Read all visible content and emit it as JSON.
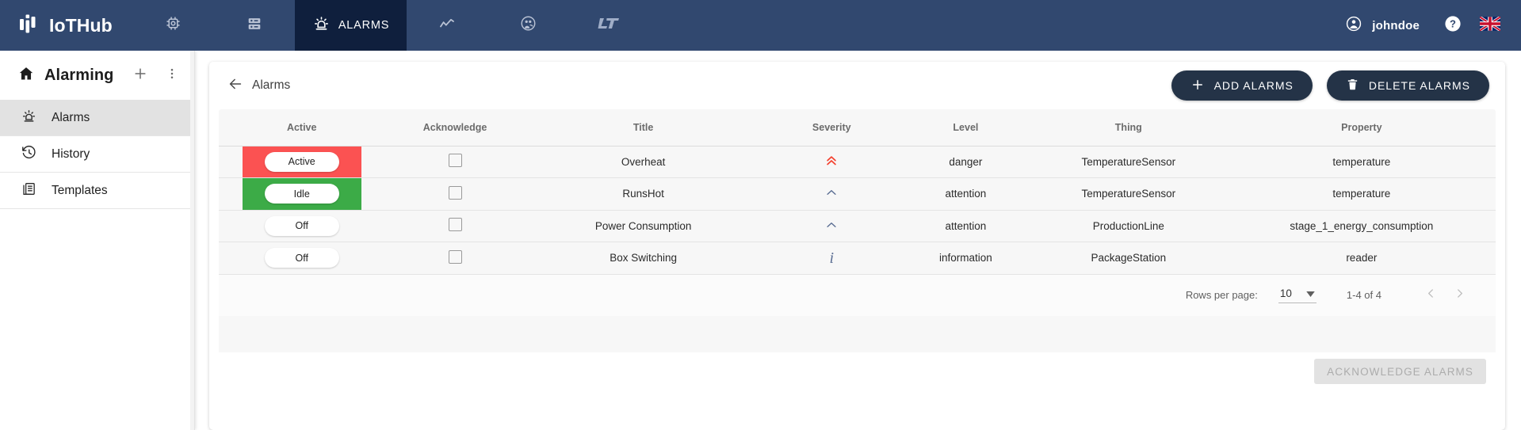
{
  "topnav": {
    "brand": "IoTHub",
    "items": [
      {
        "icon": "chip-icon",
        "label": "",
        "name": "nav-things",
        "active": false
      },
      {
        "icon": "server-rack-icon",
        "label": "",
        "name": "nav-servers",
        "active": false
      },
      {
        "icon": "alarm-light-icon",
        "label": "ALARMS",
        "name": "nav-alarms",
        "active": true
      },
      {
        "icon": "line-chart-icon",
        "label": "",
        "name": "nav-analytics",
        "active": false
      },
      {
        "icon": "users-circle-icon",
        "label": "",
        "name": "nav-users",
        "active": false
      },
      {
        "icon": "lt-logo-icon",
        "label": "",
        "name": "nav-lt-logo",
        "active": false
      }
    ],
    "user": "johndoe",
    "user_icon": "account-circle-icon",
    "help_icon": "help-circle-icon",
    "flag_icon": "uk-flag-icon",
    "bg_color": "#31486f",
    "active_bg_color": "#0f1f3d"
  },
  "sidebar": {
    "title": "Alarming",
    "home_icon": "home-icon",
    "add_icon": "plus-icon",
    "more_icon": "more-vertical-icon",
    "items": [
      {
        "label": "Alarms",
        "icon": "alarm-light-icon",
        "selected": true
      },
      {
        "label": "History",
        "icon": "history-icon",
        "selected": false
      },
      {
        "label": "Templates",
        "icon": "templates-icon",
        "selected": false
      }
    ]
  },
  "main": {
    "back_icon": "arrow-left-icon",
    "breadcrumb": "Alarms",
    "add_button": {
      "label": "ADD ALARMS",
      "icon": "plus-icon"
    },
    "delete_button": {
      "label": "DELETE ALARMS",
      "icon": "trash-icon"
    },
    "table": {
      "columns": [
        "Active",
        "Acknowledge",
        "Title",
        "Severity",
        "Level",
        "Thing",
        "Property"
      ],
      "rows": [
        {
          "active_state": "Active",
          "active_bg": "#fb5252",
          "acknowledged": false,
          "title": "Overheat",
          "severity_icon": "double-chevron-up-icon",
          "severity_color": "#f4402e",
          "level": "danger",
          "thing": "TemperatureSensor",
          "property": "temperature"
        },
        {
          "active_state": "Idle",
          "active_bg": "#3cab47",
          "acknowledged": false,
          "title": "RunsHot",
          "severity_icon": "chevron-up-icon",
          "severity_color": "#5b6e93",
          "level": "attention",
          "thing": "TemperatureSensor",
          "property": "temperature"
        },
        {
          "active_state": "Off",
          "active_bg": "transparent",
          "acknowledged": false,
          "title": "Power Consumption",
          "severity_icon": "chevron-up-icon",
          "severity_color": "#5b6e93",
          "level": "attention",
          "thing": "ProductionLine",
          "property": "stage_1_energy_consumption"
        },
        {
          "active_state": "Off",
          "active_bg": "transparent",
          "acknowledged": false,
          "title": "Box Switching",
          "severity_icon": "info-italic-icon",
          "severity_color": "#5b6e93",
          "level": "information",
          "thing": "PackageStation",
          "property": "reader"
        }
      ]
    },
    "pagination": {
      "rows_per_page_label": "Rows per page:",
      "rows_per_page_value": "10",
      "dropdown_icon": "caret-down-icon",
      "range_label": "1-4 of 4",
      "prev_icon": "chevron-left-icon",
      "next_icon": "chevron-right-icon"
    },
    "acknowledge_button": {
      "label": "ACKNOWLEDGE ALARMS",
      "disabled": true
    }
  }
}
